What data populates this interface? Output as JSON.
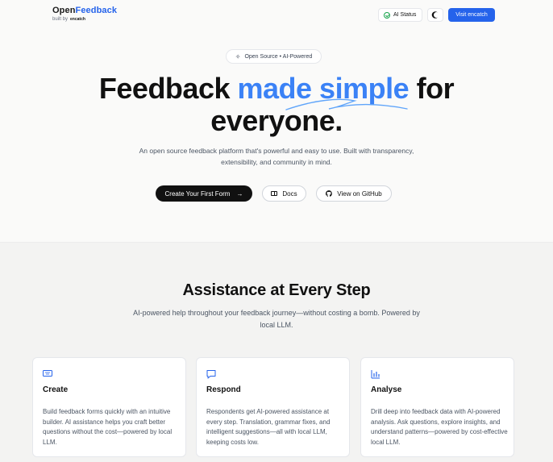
{
  "brand": {
    "name_part1": "Open",
    "name_part2": "Feedback",
    "built_by": "built by",
    "built_by_logo": "encatch"
  },
  "header": {
    "ai_status_label": "AI Status",
    "theme_icon": "moon-icon",
    "visit_label": "Visit encatch"
  },
  "hero": {
    "pill_label": "Open Source • AI-Powered",
    "title_part1": "Feedback ",
    "title_highlight": "made simple",
    "title_part2": " for",
    "title_line2": "everyone.",
    "subtitle": "An open source feedback platform that's powerful and easy to use. Built with transparency, extensibility, and community in mind.",
    "cta_primary": "Create Your First Form",
    "cta_docs": "Docs",
    "cta_github": "View on GitHub"
  },
  "assistance": {
    "title": "Assistance at Every Step",
    "subtitle": "AI-powered help throughout your feedback journey—without costing a bomb. Powered by local LLM.",
    "cards": [
      {
        "icon": "keyboard-icon",
        "title": "Create",
        "text": "Build feedback forms quickly with an intuitive builder. AI assistance helps you craft better questions without the cost—powered by local LLM."
      },
      {
        "icon": "message-icon",
        "title": "Respond",
        "text": "Respondents get AI-powered assistance at every step. Translation, grammar fixes, and intelligent suggestions—all with local LLM, keeping costs low."
      },
      {
        "icon": "bar-chart-icon",
        "title": "Analyse",
        "text": "Drill deep into feedback data with AI-powered analysis. Ask questions, explore insights, and understand patterns—powered by cost-effective local LLM."
      }
    ]
  },
  "colors": {
    "accent": "#2563eb",
    "highlight": "#3b82f6",
    "dark": "#111111",
    "status_ok": "#16a34a"
  }
}
